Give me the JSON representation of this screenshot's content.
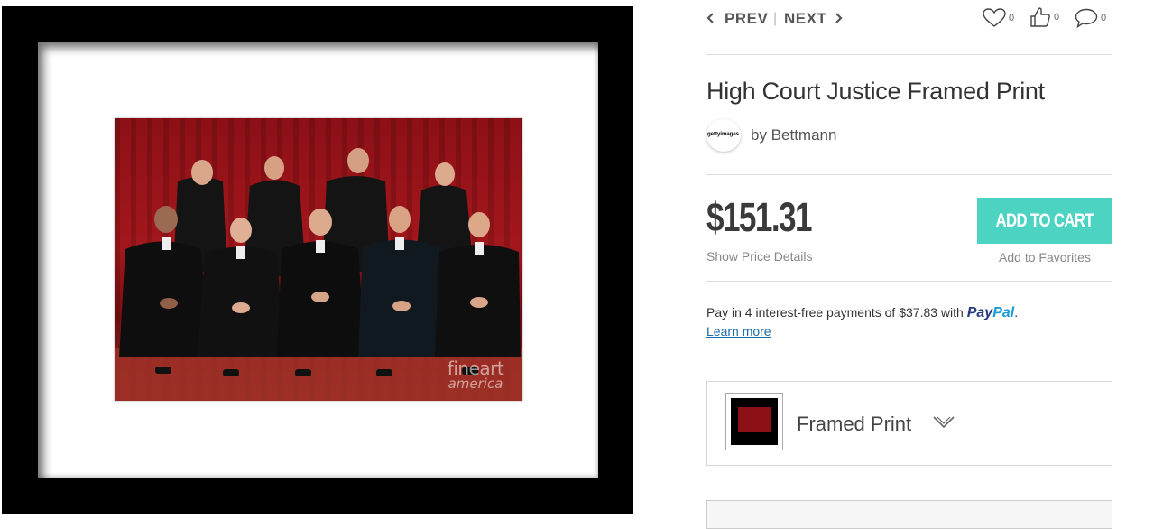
{
  "preview": {
    "watermark_line1": "fineart",
    "watermark_line2": "america"
  },
  "nav": {
    "prev_label": "PREV",
    "separator": "|",
    "next_label": "NEXT",
    "prev_icon": "chevron-left-icon",
    "next_icon": "chevron-right-icon"
  },
  "social": {
    "likes": "0",
    "thumbs": "0",
    "comments": "0"
  },
  "product": {
    "title": "High Court Justice Framed Print",
    "artist": "by Bettmann",
    "artist_logo_text": "gettyimages",
    "price": "$151.31",
    "price_details_label": "Show Price Details",
    "add_to_cart_label": "ADD TO CART",
    "favorites_label": "Add to Favorites"
  },
  "paypal": {
    "text": "Pay in 4 interest-free payments of $37.83 with ",
    "logo_part1": "Pay",
    "logo_part2": "Pal",
    "suffix": ".",
    "learn_more": "Learn more"
  },
  "product_type": {
    "label": "Framed Print",
    "icon": "chevron-down-icon"
  },
  "colors": {
    "accent": "#4cd3c2",
    "paypal_dark": "#253b80",
    "paypal_light": "#179bd7",
    "link": "#1f6ca8"
  }
}
